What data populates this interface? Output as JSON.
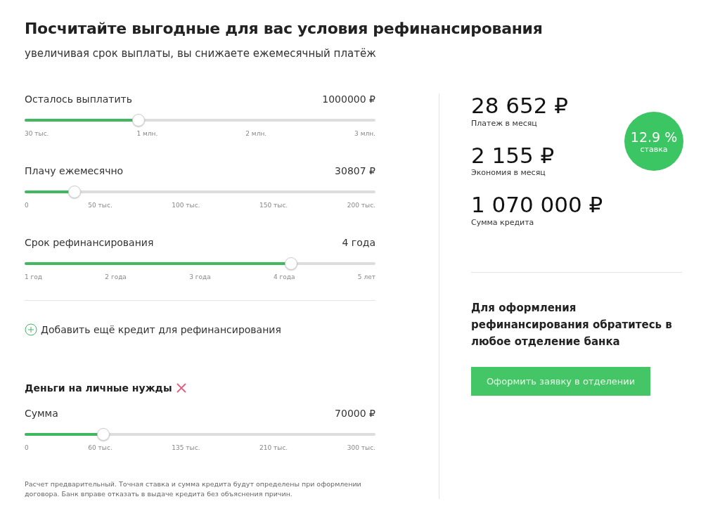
{
  "title": "Посчитайте выгодные для вас условия рефинансирования",
  "subtitle": "увеличивая срок выплаты, вы снижаете ежемесячный платёж",
  "sliders": [
    {
      "label": "Осталось выплатить",
      "value": "1000000 ₽",
      "level": 0.33,
      "ticks": [
        "30 тыс.",
        "1 млн.",
        "2 млн.",
        "3 млн."
      ]
    },
    {
      "label": "Плачу ежемесячно",
      "value": "30807 ₽",
      "level": 0.154,
      "ticks": [
        "0",
        "50 тыс.",
        "100 тыс.",
        "150 тыс.",
        "200 тыс."
      ]
    },
    {
      "label": "Срок рефинансирования",
      "value": "4 года",
      "level": 0.75,
      "ticks": [
        "1 год",
        "2 года",
        "3 года",
        "4 года",
        "5 лет"
      ]
    }
  ],
  "add_credit_link": "Добавить ещё кредит для рефинансирования",
  "personal": {
    "title": "Деньги на личные нужды",
    "slider": {
      "label": "Сумма",
      "value": "70000 ₽",
      "level": 0.234,
      "ticks": [
        "0",
        "60 тыс.",
        "135 тыс.",
        "210 тыс.",
        "300 тыс."
      ]
    }
  },
  "disclaimer": "Расчет предварительный. Точная ставка и сумма кредита будут определены при оформлении договора. Банк вправе отказать в выдаче кредита без объяснения причин.",
  "results": [
    {
      "amount": "28 652 ₽",
      "caption": "Платеж в месяц"
    },
    {
      "amount": "2 155 ₽",
      "caption": "Экономия в месяц"
    },
    {
      "amount": "1 070 000 ₽",
      "caption": "Сумма кредита"
    }
  ],
  "rate": {
    "value": "12.9 %",
    "caption": "ставка"
  },
  "note": "Для оформления рефинансирования обратитесь в любое отделение банка",
  "apply_button": "Оформить заявку в отделении"
}
